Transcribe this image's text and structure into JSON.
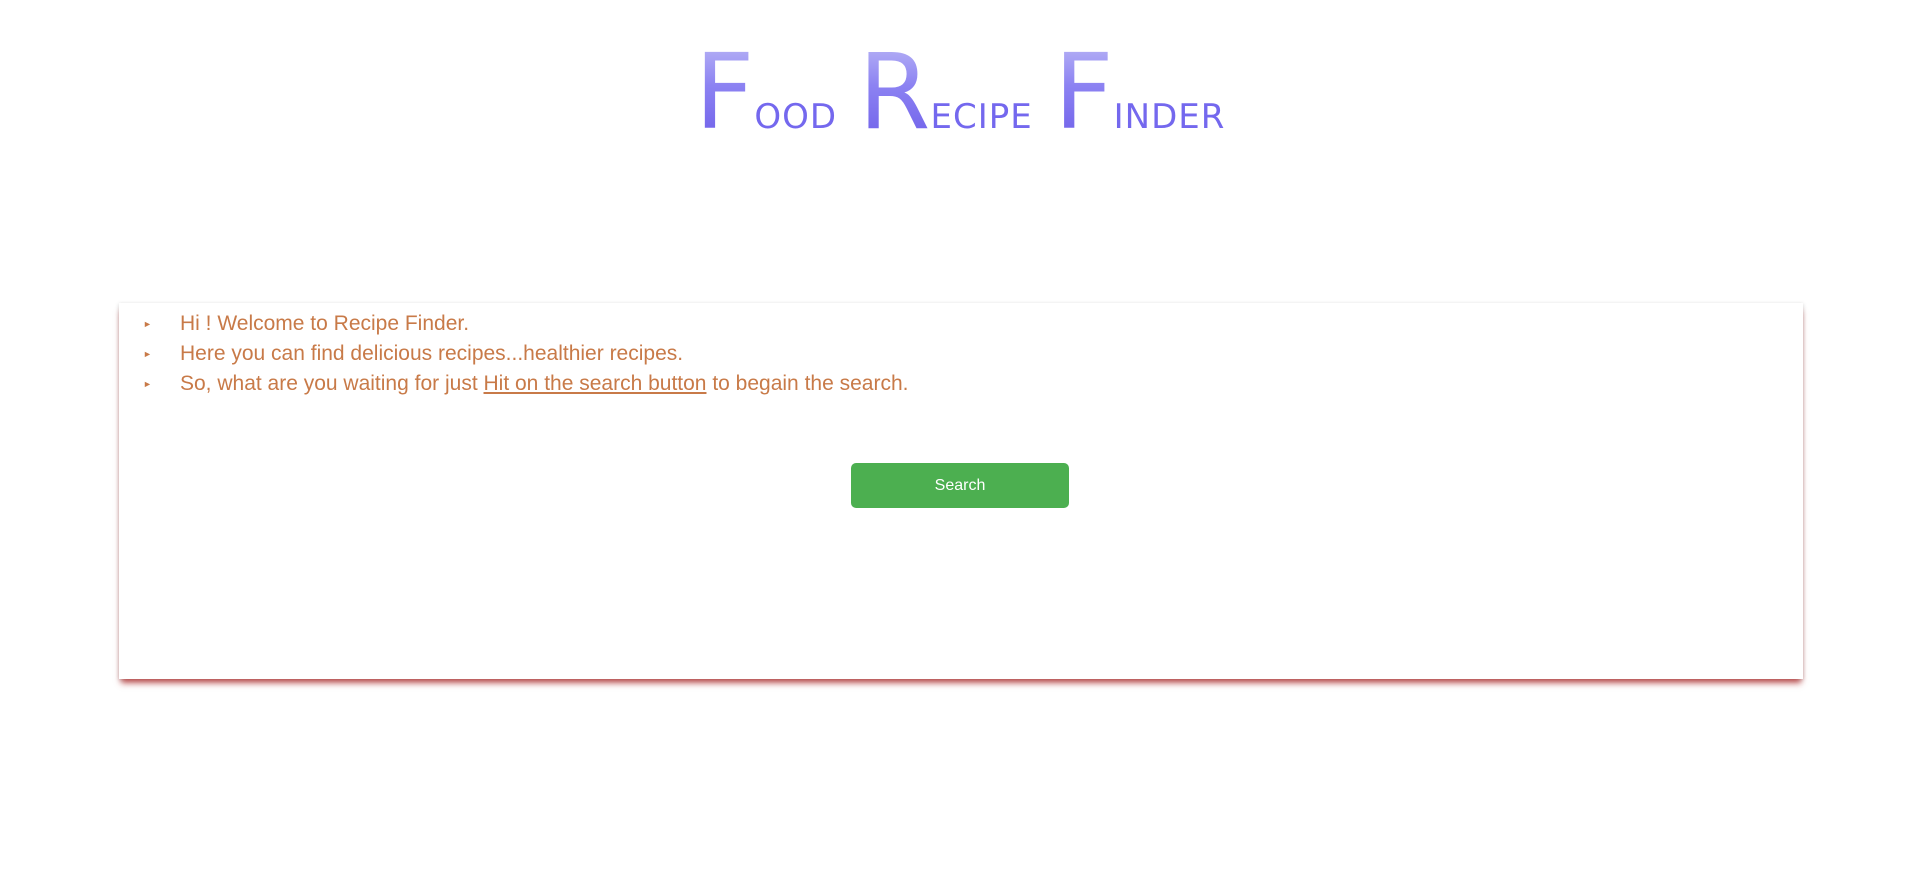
{
  "logo": {
    "word1": {
      "cap": "F",
      "rest": "ood"
    },
    "word2": {
      "cap": "R",
      "rest": "ecipe"
    },
    "word3": {
      "cap": "F",
      "rest": "inder"
    }
  },
  "intro": {
    "bullet_icon": "triangle-right-small",
    "line1": "Hi ! Welcome to Recipe Finder.",
    "line2": "Here you can find delicious recipes...healthier recipes.",
    "line3_before": "So, what are you waiting for just ",
    "line3_link": "Hit on the search button",
    "line3_after": " to begain the search.",
    "text_color": "#c87a48"
  },
  "search_button": {
    "label": "Search",
    "color": "#4caf50"
  },
  "colors": {
    "logo": "#7468ee",
    "card_shadow": "#aa1e1e"
  }
}
